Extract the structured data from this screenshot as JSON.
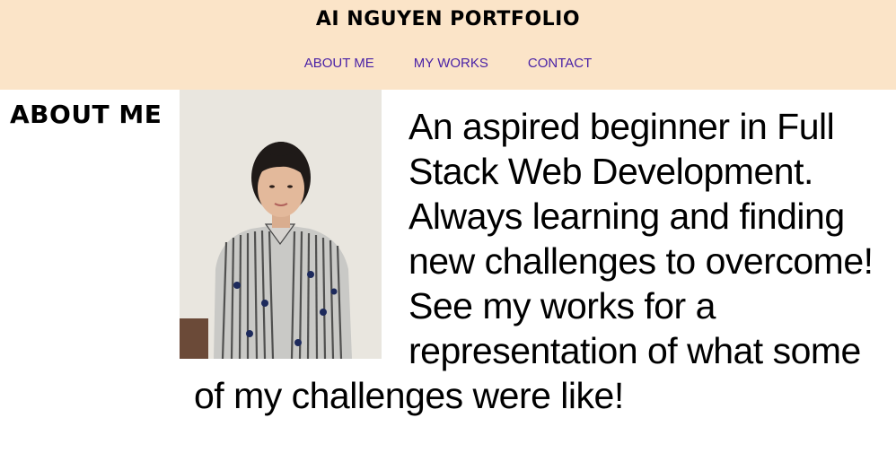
{
  "header": {
    "title": "AI NGUYEN PORTFOLIO",
    "nav": [
      {
        "label": "ABOUT ME"
      },
      {
        "label": "MY WORKS"
      },
      {
        "label": "CONTACT"
      }
    ],
    "background_color": "#fbe4c8",
    "nav_color": "#4a22a6"
  },
  "about": {
    "heading": "ABOUT ME",
    "photo_icon": "portrait-photo",
    "bio": "An aspired beginner in Full Stack Web Development. Always learning and finding new challenges to overcome! See my works for a representation of what some of my challenges were like!"
  }
}
